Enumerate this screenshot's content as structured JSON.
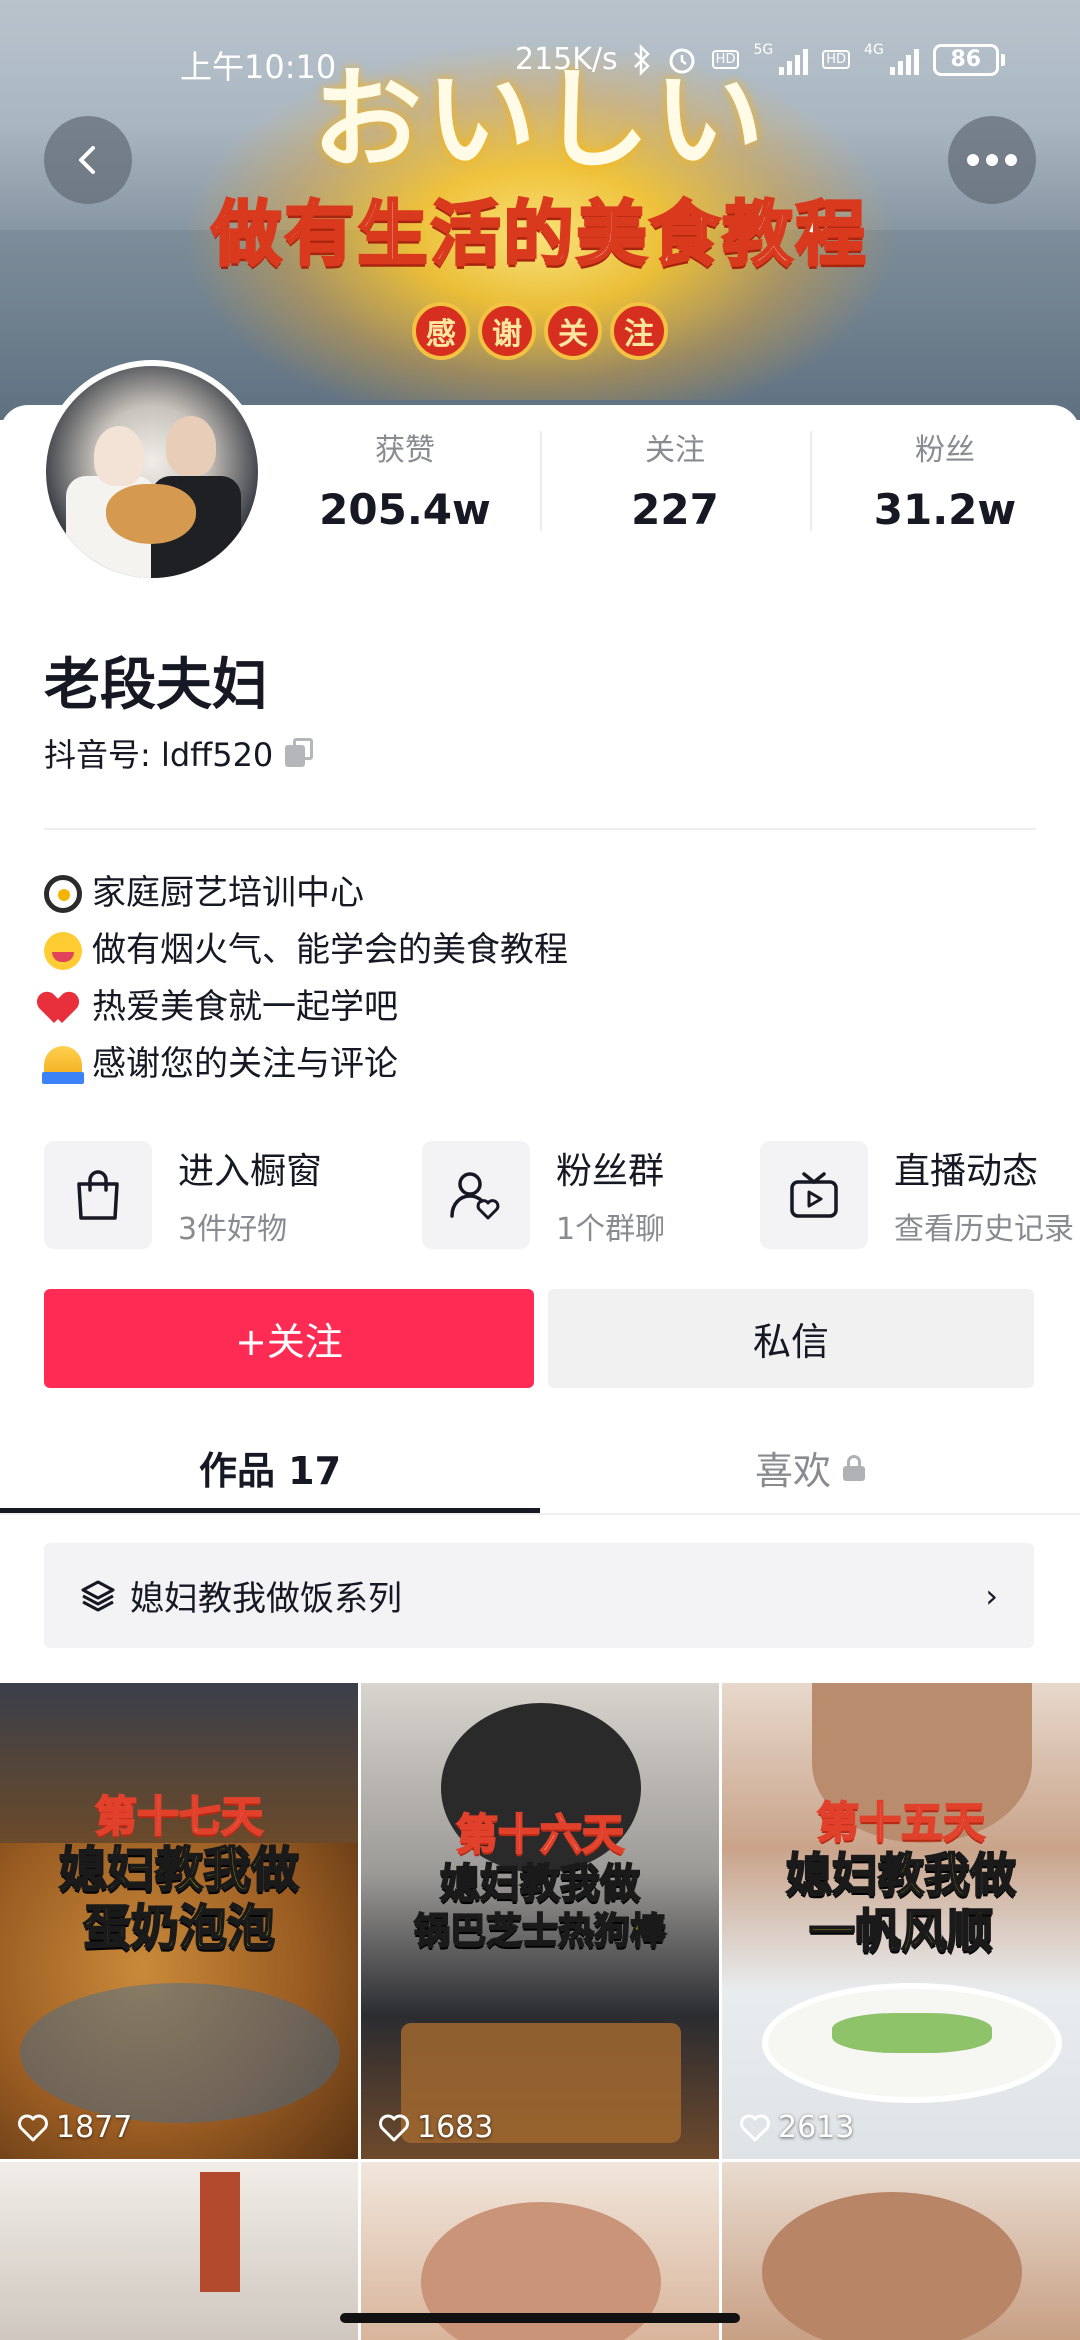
{
  "status_bar": {
    "time": "上午10:10",
    "net_speed": "215K/s",
    "sim1_tag": "5G",
    "sim2_tag": "4G",
    "hd": "HD",
    "battery": "86"
  },
  "banner": {
    "title_top": "おいしい",
    "title_main": "做有生活的美食教程",
    "badges": [
      "感",
      "谢",
      "关",
      "注"
    ]
  },
  "profile": {
    "stats": [
      {
        "label": "获赞",
        "value": "205.4w"
      },
      {
        "label": "关注",
        "value": "227"
      },
      {
        "label": "粉丝",
        "value": "31.2w"
      }
    ],
    "name": "老段夫妇",
    "douyin_id": "抖音号: ldff520",
    "bio": [
      {
        "icon": "frying-pan",
        "text": "家庭厨艺培训中心"
      },
      {
        "icon": "smile",
        "text": "做有烟火气、能学会的美食教程"
      },
      {
        "icon": "heart",
        "text": "热爱美食就一起学吧"
      },
      {
        "icon": "pray",
        "text": "感谢您的关注与评论"
      }
    ]
  },
  "quick_links": [
    {
      "title": "进入橱窗",
      "subtitle": "3件好物",
      "icon": "shopping-bag-icon"
    },
    {
      "title": "粉丝群",
      "subtitle": "1个群聊",
      "icon": "fan-group-icon"
    },
    {
      "title": "直播动态",
      "subtitle": "查看历史记录",
      "icon": "live-tv-icon"
    }
  ],
  "actions": {
    "follow": "+关注",
    "message": "私信"
  },
  "tabs": {
    "works": "作品 17",
    "likes": "喜欢"
  },
  "series": {
    "label": "媳妇教我做饭系列"
  },
  "videos": [
    {
      "day": "第十七天",
      "title_line1": "媳妇教我做",
      "title_line2": "蛋奶泡泡",
      "likes": "1877"
    },
    {
      "day": "第十六天",
      "title_line1": "媳妇教我做",
      "title_line2": "锅巴芝士热狗棒",
      "likes": "1683"
    },
    {
      "day": "第十五天",
      "title_line1": "媳妇教我做",
      "title_line2": "一帆风顺",
      "likes": "2613"
    }
  ],
  "colors": {
    "primary": "#fe2c55",
    "text": "#161823",
    "muted": "#8a8b91",
    "surface": "#f3f3f5"
  }
}
